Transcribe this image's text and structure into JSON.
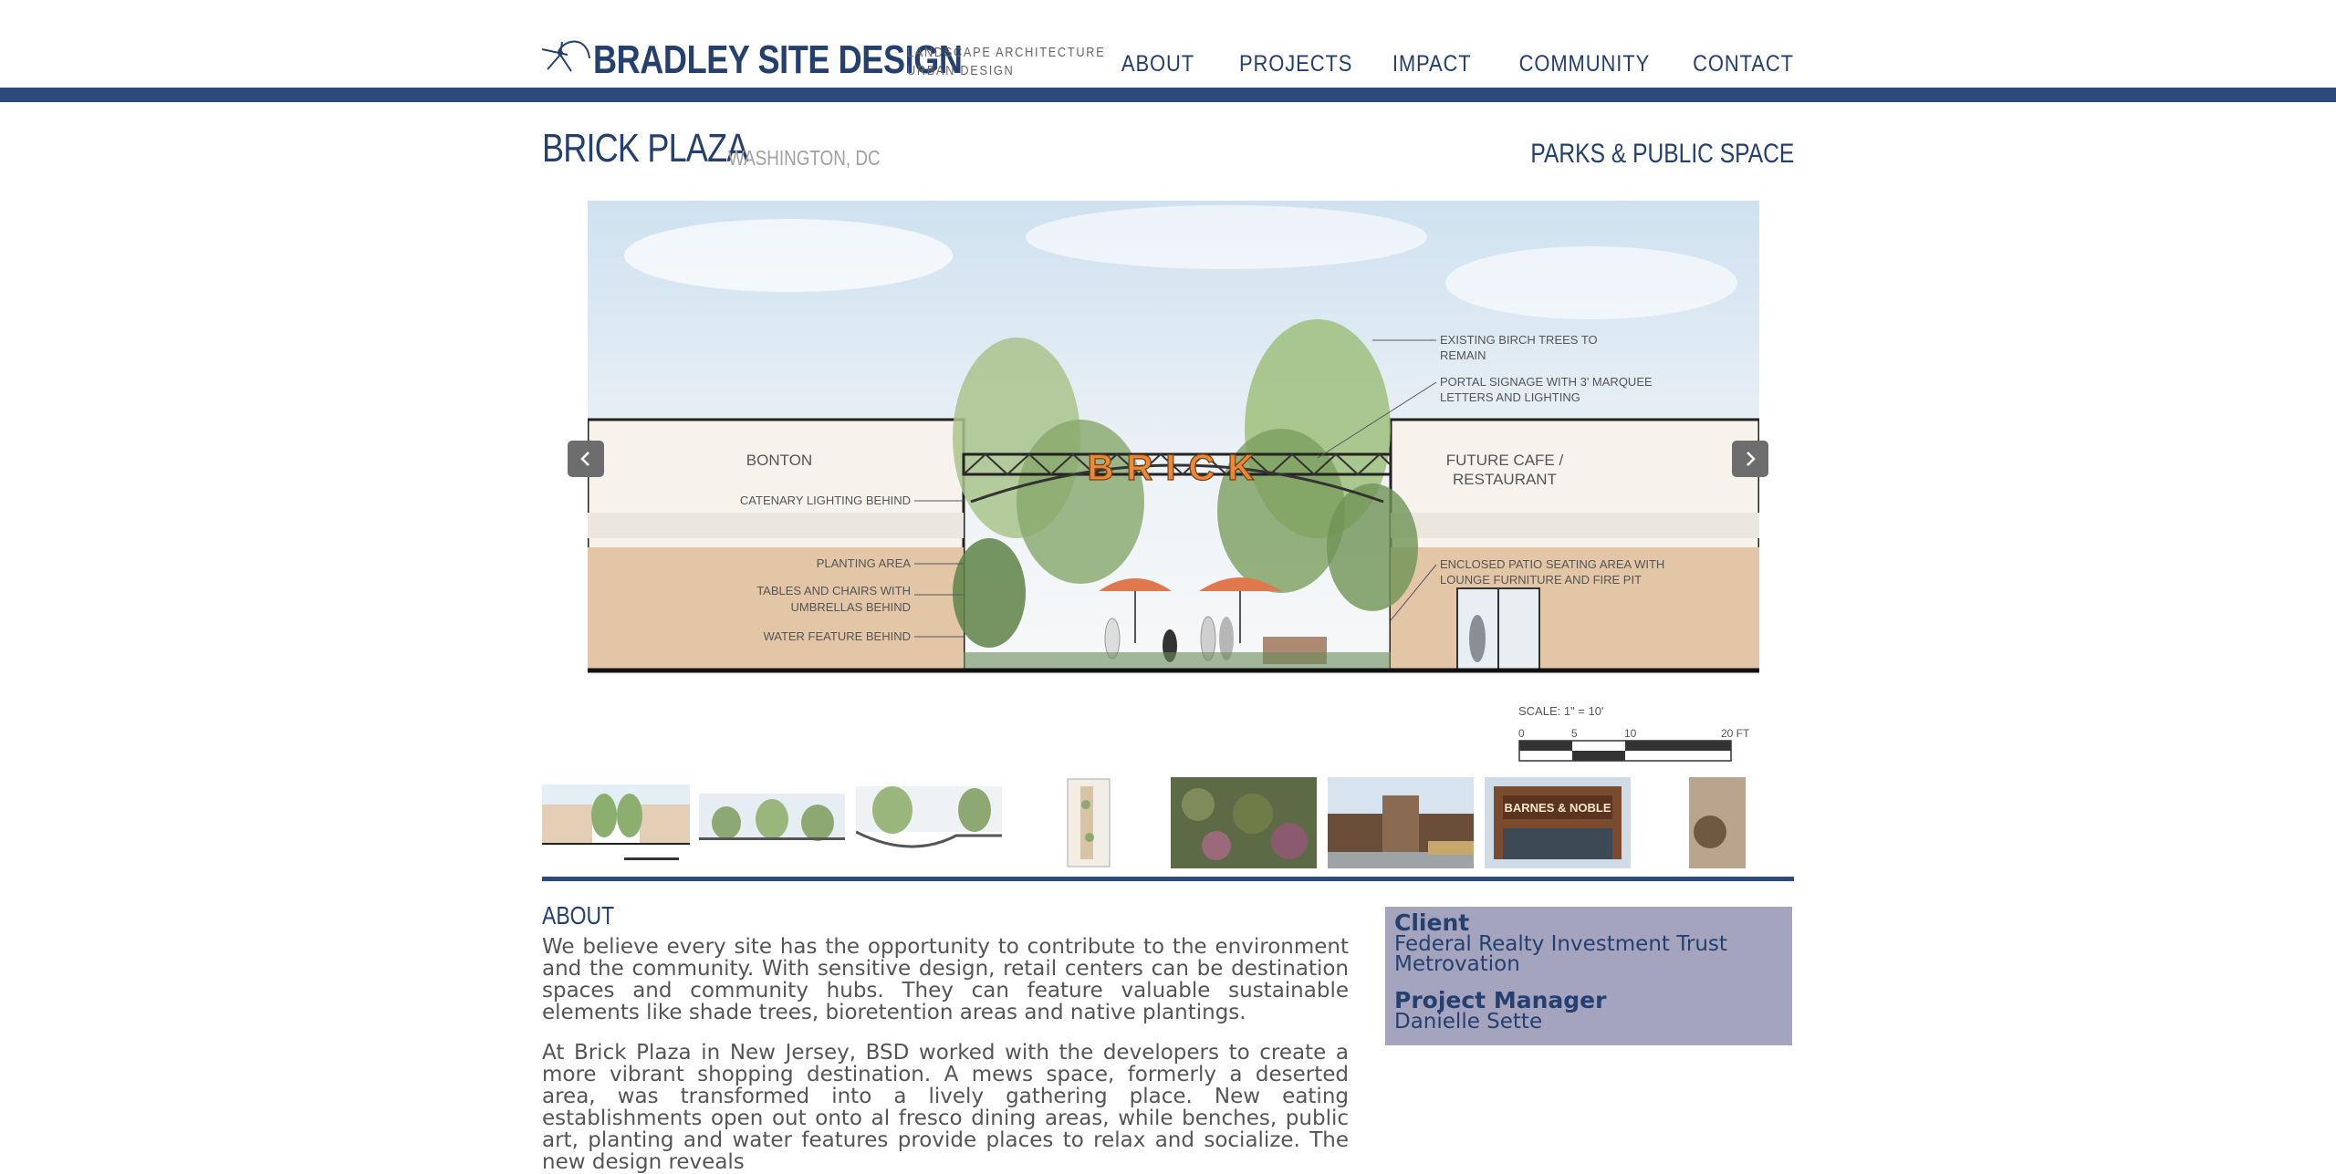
{
  "header": {
    "logo_text": "BRADLEY SITE DESIGN",
    "logo_sub_1": "LANDSCAPE ARCHITECTURE",
    "logo_sub_2": "URBAN DESIGN",
    "nav": [
      "ABOUT",
      "PROJECTS",
      "IMPACT",
      "COMMUNITY",
      "CONTACT"
    ]
  },
  "project": {
    "title": "BRICK PLAZA",
    "location": "WASHINGTON, DC",
    "category": "PARKS & PUBLIC SPACE"
  },
  "slide": {
    "sign": "BRICK",
    "labels": {
      "bonton": "BONTON",
      "catenary": "CATENARY LIGHTING BEHIND",
      "planting": "PLANTING AREA",
      "tables_1": "TABLES AND CHAIRS WITH",
      "tables_2": "UMBRELLAS BEHIND",
      "water": "WATER FEATURE BEHIND",
      "birch_1": "EXISTING BIRCH TREES TO",
      "birch_2": "REMAIN",
      "portal_1": "PORTAL SIGNAGE WITH 3' MARQUEE",
      "portal_2": "LETTERS AND LIGHTING",
      "cafe_1": "FUTURE CAFE /",
      "cafe_2": "RESTAURANT",
      "patio_1": "ENCLOSED PATIO SEATING AREA WITH",
      "patio_2": "LOUNGE FURNITURE AND FIRE PIT"
    },
    "scale_label": "SCALE: 1\" = 10'",
    "scale_ticks": [
      "0",
      "5",
      "10",
      "20 FT"
    ]
  },
  "thumbnail_signs": {
    "barnes": "BARNES & NOBLE"
  },
  "about": {
    "heading": "ABOUT",
    "para1": "We believe every site has the opportunity to contribute to the environment and the community. With sensitive design, retail centers can be destination spaces and community hubs. They can feature valuable sustainable elements like shade trees, bioretention areas and native plantings.",
    "para2": "At Brick Plaza in New Jersey, BSD worked with the developers to create a more vibrant shopping destination. A mews space, formerly a deserted area, was transformed into a lively gathering place. New eating establishments open out onto al fresco dining areas, while benches, public art, planting and water features provide places to relax and socialize. The new design reveals"
  },
  "info": {
    "client_label": "Client",
    "client_1": "Federal Realty Investment Trust",
    "client_2": "Metrovation",
    "pm_label": "Project Manager",
    "pm": "Danielle Sette"
  },
  "colors": {
    "brand_navy": "#25406e",
    "bar": "#2c4a7c",
    "info_box": "#a5a4bf",
    "arrow": "#6d6d6d"
  }
}
